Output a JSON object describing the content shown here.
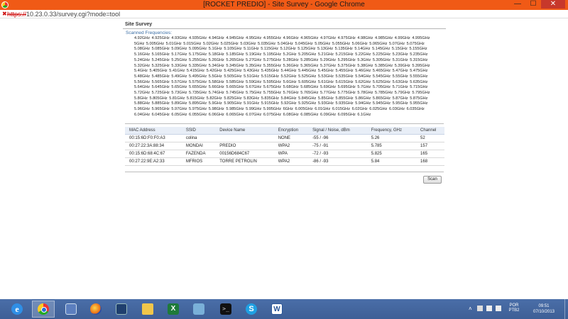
{
  "window": {
    "title": "[ROCKET PREDIO] - Site Survey - Google Chrome",
    "minimize_label": "—",
    "maximize_label": "☐",
    "close_label": "✕"
  },
  "address_bar": {
    "scheme": "https://",
    "rest": "10.23.0.33/survey.cgi?mode=tool"
  },
  "page": {
    "section_title": "Site Survey",
    "scanned_label": "Scanned Frequencies:",
    "frequencies": [
      "4.92GHz",
      "4.925GHz",
      "4.93GHz",
      "4.935GHz",
      "4.94GHz",
      "4.945GHz",
      "4.95GHz",
      "4.955GHz",
      "4.96GHz",
      "4.965GHz",
      "4.97GHz",
      "4.975GHz",
      "4.98GHz",
      "4.985GHz",
      "4.99GHz",
      "4.995GHz",
      "5GHz",
      "5.005GHz",
      "5.01GHz",
      "5.015GHz",
      "5.02GHz",
      "5.025GHz",
      "5.03GHz",
      "5.035GHz",
      "5.04GHz",
      "5.045GHz",
      "5.05GHz",
      "5.055GHz",
      "5.06GHz",
      "5.065GHz",
      "5.07GHz",
      "5.075GHz",
      "5.08GHz",
      "5.085GHz",
      "5.09GHz",
      "5.095GHz",
      "5.1GHz",
      "5.105GHz",
      "5.11GHz",
      "5.115GHz",
      "5.12GHz",
      "5.125GHz",
      "5.13GHz",
      "5.135GHz",
      "5.14GHz",
      "5.145GHz",
      "5.15GHz",
      "5.155GHz",
      "5.16GHz",
      "5.165GHz",
      "5.17GHz",
      "5.175GHz",
      "5.18GHz",
      "5.185GHz",
      "5.19GHz",
      "5.195GHz",
      "5.2GHz",
      "5.205GHz",
      "5.21GHz",
      "5.215GHz",
      "5.22GHz",
      "5.225GHz",
      "5.23GHz",
      "5.235GHz",
      "5.24GHz",
      "5.245GHz",
      "5.25GHz",
      "5.255GHz",
      "5.26GHz",
      "5.265GHz",
      "5.27GHz",
      "5.275GHz",
      "5.28GHz",
      "5.285GHz",
      "5.29GHz",
      "5.295GHz",
      "5.3GHz",
      "5.305GHz",
      "5.31GHz",
      "5.315GHz",
      "5.32GHz",
      "5.325GHz",
      "5.33GHz",
      "5.335GHz",
      "5.34GHz",
      "5.345GHz",
      "5.35GHz",
      "5.355GHz",
      "5.36GHz",
      "5.365GHz",
      "5.37GHz",
      "5.375GHz",
      "5.38GHz",
      "5.385GHz",
      "5.39GHz",
      "5.395GHz",
      "5.4GHz",
      "5.405GHz",
      "5.41GHz",
      "5.415GHz",
      "5.42GHz",
      "5.425GHz",
      "5.43GHz",
      "5.435GHz",
      "5.44GHz",
      "5.445GHz",
      "5.45GHz",
      "5.455GHz",
      "5.46GHz",
      "5.465GHz",
      "5.47GHz",
      "5.475GHz",
      "5.48GHz",
      "5.485GHz",
      "5.49GHz",
      "5.495GHz",
      "5.5GHz",
      "5.505GHz",
      "5.51GHz",
      "5.515GHz",
      "5.52GHz",
      "5.525GHz",
      "5.53GHz",
      "5.535GHz",
      "5.54GHz",
      "5.545GHz",
      "5.55GHz",
      "5.555GHz",
      "5.56GHz",
      "5.565GHz",
      "5.57GHz",
      "5.575GHz",
      "5.58GHz",
      "5.585GHz",
      "5.59GHz",
      "5.595GHz",
      "5.6GHz",
      "5.605GHz",
      "5.61GHz",
      "5.615GHz",
      "5.62GHz",
      "5.625GHz",
      "5.63GHz",
      "5.635GHz",
      "5.64GHz",
      "5.645GHz",
      "5.65GHz",
      "5.655GHz",
      "5.66GHz",
      "5.665GHz",
      "5.67GHz",
      "5.675GHz",
      "5.68GHz",
      "5.685GHz",
      "5.69GHz",
      "5.695GHz",
      "5.7GHz",
      "5.705GHz",
      "5.71GHz",
      "5.715GHz",
      "5.72GHz",
      "5.725GHz",
      "5.73GHz",
      "5.735GHz",
      "5.74GHz",
      "5.745GHz",
      "5.75GHz",
      "5.755GHz",
      "5.76GHz",
      "5.765GHz",
      "5.77GHz",
      "5.775GHz",
      "5.78GHz",
      "5.785GHz",
      "5.79GHz",
      "5.795GHz",
      "5.8GHz",
      "5.805GHz",
      "5.81GHz",
      "5.815GHz",
      "5.82GHz",
      "5.825GHz",
      "5.83GHz",
      "5.835GHz",
      "5.84GHz",
      "5.845GHz",
      "5.85GHz",
      "5.855GHz",
      "5.86GHz",
      "5.865GHz",
      "5.87GHz",
      "5.875GHz",
      "5.88GHz",
      "5.885GHz",
      "5.89GHz",
      "5.895GHz",
      "5.9GHz",
      "5.905GHz",
      "5.91GHz",
      "5.915GHz",
      "5.92GHz",
      "5.925GHz",
      "5.93GHz",
      "5.935GHz",
      "5.94GHz",
      "5.945GHz",
      "5.95GHz",
      "5.955GHz",
      "5.96GHz",
      "5.965GHz",
      "5.97GHz",
      "5.975GHz",
      "5.98GHz",
      "5.985GHz",
      "5.99GHz",
      "5.995GHz",
      "6GHz",
      "6.005GHz",
      "6.01GHz",
      "6.015GHz",
      "6.02GHz",
      "6.025GHz",
      "6.03GHz",
      "6.035GHz",
      "6.04GHz",
      "6.045GHz",
      "6.05GHz",
      "6.055GHz",
      "6.06GHz",
      "6.065GHz",
      "6.07GHz",
      "6.075GHz",
      "6.08GHz",
      "6.085GHz",
      "6.09GHz",
      "6.095GHz",
      "6.1GHz"
    ],
    "table": {
      "headers": [
        "MAC Address",
        "SSID",
        "Device Name",
        "Encryption",
        "Signal / Noise, dBm",
        "Frequency, GHz",
        "Channel"
      ],
      "rows": [
        [
          "00:15:6D:F0:F0:A3",
          "colina",
          "",
          "NONE",
          "-55 / -96",
          "5.26",
          "52"
        ],
        [
          "00:27:22:3A:88:34",
          "MONDAI",
          "PREDIO",
          "WPA2",
          "-75 / -91",
          "5.785",
          "157"
        ],
        [
          "00:15:6D:68:4C:67",
          "FAZENDA",
          "00156D684C67",
          "WPA",
          "-72 / -93",
          "5.825",
          "165"
        ],
        [
          "00:27:22:9E:A2:33",
          "MFRIOS",
          "TORRE PETROLIN",
          "WPA2",
          "-86 / -93",
          "5.84",
          "168"
        ]
      ]
    },
    "scan_button": "Scan"
  },
  "taskbar": {
    "items": [
      "ie-icon",
      "chrome-icon",
      "computer-icon",
      "firefox-icon",
      "window-icon",
      "folder-icon",
      "excel-icon",
      "calculator-icon",
      "cmd-icon",
      "skype-icon",
      "word-icon"
    ],
    "active_item": "chrome-icon",
    "language": "POR",
    "keyboard": "PTB2",
    "time": "09:51",
    "date": "07/10/2013"
  }
}
